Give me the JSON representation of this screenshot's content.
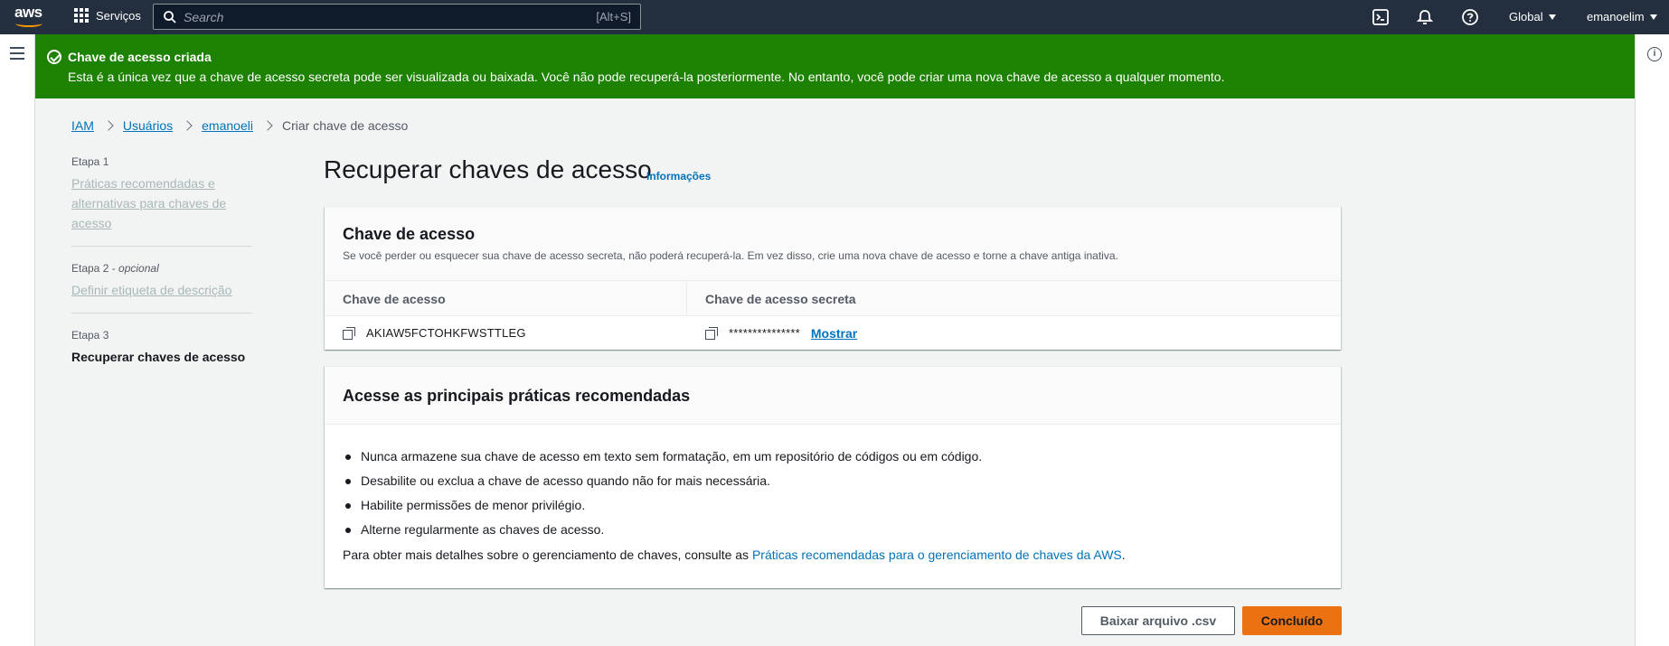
{
  "topnav": {
    "logo_text": "aws",
    "services_label": "Serviços",
    "search_placeholder": "Search",
    "search_shortcut": "[Alt+S]",
    "region_label": "Global",
    "user_label": "emanoelim"
  },
  "flash": {
    "title": "Chave de acesso criada",
    "message": "Esta é a única vez que a chave de acesso secreta pode ser visualizada ou baixada. Você não pode recuperá-la posteriormente. No entanto, você pode criar uma nova chave de acesso a qualquer momento.",
    "color": "#1d8102"
  },
  "breadcrumb": {
    "items": [
      "IAM",
      "Usuários",
      "emanoeli"
    ],
    "current": "Criar chave de acesso"
  },
  "steps": [
    {
      "label": "Etapa 1",
      "title": "Práticas recomendadas e alternativas para chaves de acesso"
    },
    {
      "label": "Etapa 2",
      "optional": "opcional",
      "title": "Definir etiqueta de descrição"
    },
    {
      "label": "Etapa 3",
      "title": "Recuperar chaves de acesso"
    }
  ],
  "main": {
    "title": "Recuperar chaves de acesso",
    "info_link": "Informações"
  },
  "access_key_panel": {
    "title": "Chave de acesso",
    "description": "Se você perder ou esquecer sua chave de acesso secreta, não poderá recuperá-la. Em vez disso, crie uma nova chave de acesso e torne a chave antiga inativa.",
    "col_access_key": "Chave de acesso",
    "col_secret_key": "Chave de acesso secreta",
    "access_key_value": "AKIAW5FCTOHKFWSTTLEG",
    "secret_key_masked": "***************",
    "show_label": "Mostrar"
  },
  "best_practices_panel": {
    "title": "Acesse as principais práticas recomendadas",
    "items": [
      "Nunca armazene sua chave de acesso em texto sem formatação, em um repositório de códigos ou em código.",
      "Desabilite ou exclua a chave de acesso quando não for mais necessária.",
      "Habilite permissões de menor privilégio.",
      "Alterne regularmente as chaves de acesso."
    ],
    "more_prefix": "Para obter mais detalhes sobre o gerenciamento de chaves, consulte as ",
    "more_link": "Práticas recomendadas para o gerenciamento de chaves da AWS",
    "more_suffix": "."
  },
  "actions": {
    "download_csv": "Baixar arquivo .csv",
    "done": "Concluído"
  },
  "colors": {
    "nav_bg": "#232f3e",
    "brand_orange": "#ff9900",
    "primary_button": "#ec7211",
    "link": "#0073bb"
  }
}
